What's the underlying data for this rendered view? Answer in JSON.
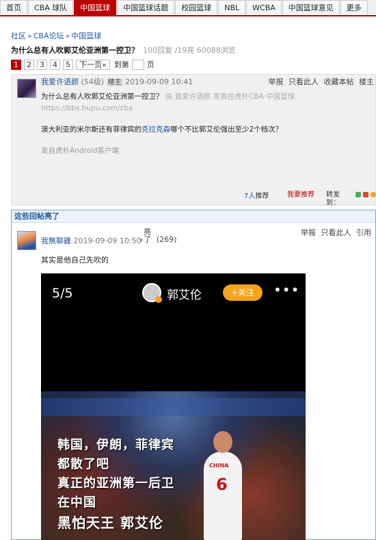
{
  "nav": {
    "tabs": [
      "首页",
      "CBA 球队",
      "中国篮球",
      "中国篮球话题",
      "校园篮球",
      "NBL",
      "WCBA",
      "中国篮球意见",
      "更多"
    ],
    "active_index": 2
  },
  "breadcrumb": [
    "社区",
    "CBA论坛",
    "中国篮球"
  ],
  "thread": {
    "title": "为什么总有人吹郭艾伦亚洲第一控卫？",
    "stats": "100回复 /19亮  60088浏览"
  },
  "pager": {
    "pages": [
      "1",
      "2",
      "3",
      "4",
      "5"
    ],
    "current": "1",
    "next": "下一页»",
    "jump_prefix": "到第",
    "jump_suffix": "页"
  },
  "main_post": {
    "username": "我爱许语颜",
    "level": "(54级)",
    "role": "楼主",
    "datetime": "2019-09-09 10:41",
    "actions": [
      "举报",
      "只看此人",
      "收藏本帖",
      "楼主"
    ],
    "quote_title": "为什么总有人吹郭艾伦亚洲第一控卫？",
    "quote_source": "由 我爱许语颜 发表在虎扑CBA·中国篮球 https://bbs.hupu.com/cba",
    "body_before_link": "澳大利亚的米尔斯还有菲律宾的",
    "body_link": "克拉克森",
    "body_after_link": "哪个不比郭艾伦强出至少2个档次？",
    "client": "发自虎扑Android客户端",
    "recommend_count": "7人",
    "recommend_label": "推荐",
    "my_recommend": "我要推荐",
    "share_label": "转发到：",
    "share_icons": [
      "wechat-icon",
      "weibo-icon",
      "qzone-icon"
    ],
    "share_colors": [
      "#4caf50",
      "#e0452b",
      "#f2a720"
    ]
  },
  "replies": {
    "header": "这些回帖亮了",
    "items": [
      {
        "username": "我無聊雞",
        "datetime": "2019-09-09 10:50",
        "light_label": "亮了",
        "light_count": "(269)",
        "actions": [
          "举报",
          "只看此人",
          "引用"
        ],
        "text": "其实是他自己先吹的",
        "image": {
          "page_indicator": "5/5",
          "account_name": "郭艾伦",
          "follow_label": "+关注",
          "more": "•••",
          "jersey_text": "CHINA",
          "jersey_number": "6",
          "caption_lines": [
            "韩国，伊朗，菲律宾",
            "都散了吧",
            "真正的亚洲第一后卫",
            "在中国",
            "黑怕天王 郭艾伦"
          ]
        }
      }
    ]
  }
}
